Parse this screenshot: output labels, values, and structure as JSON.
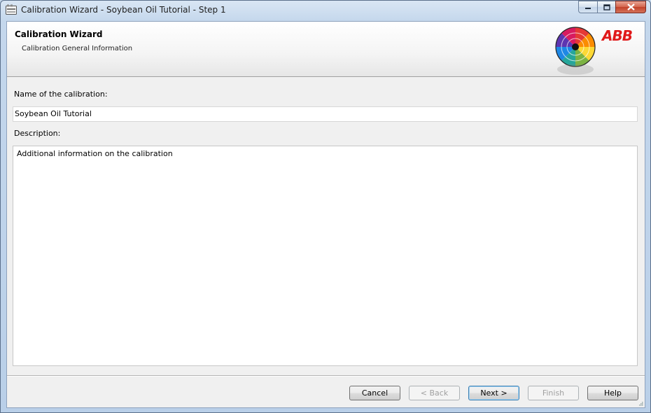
{
  "window": {
    "title": "Calibration Wizard - Soybean Oil Tutorial - Step 1",
    "controls": [
      "minimize-icon",
      "maximize-icon",
      "close-icon"
    ]
  },
  "header": {
    "title": "Calibration Wizard",
    "subtitle": "Calibration General Information",
    "logo_text": "ABB"
  },
  "form": {
    "name_label": "Name of the calibration:",
    "name_value": "Soybean Oil Tutorial",
    "description_label": "Description:",
    "description_value": "Additional information on the calibration"
  },
  "buttons": {
    "cancel": "Cancel",
    "back": "< Back",
    "next": "Next >",
    "finish": "Finish",
    "help": "Help"
  },
  "colors": {
    "accent_red": "#e0191a",
    "default_button_border": "#3c7fb1"
  }
}
